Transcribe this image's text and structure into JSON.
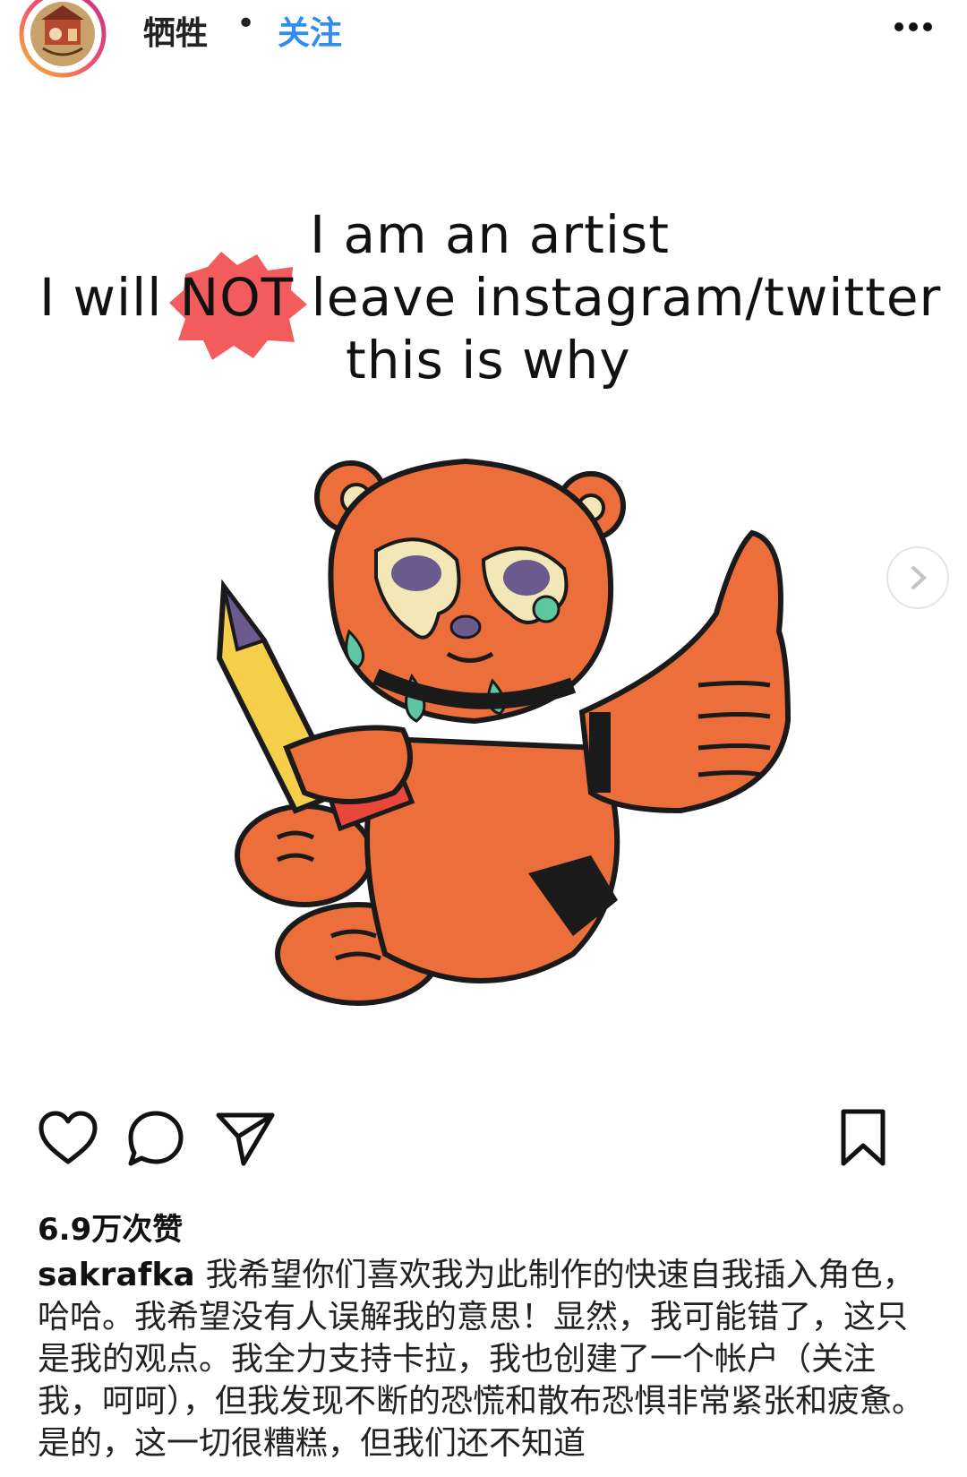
{
  "header": {
    "username": "牺牲",
    "separator": "•",
    "follow_label": "关注",
    "more_icon": "more-horizontal-icon"
  },
  "post": {
    "line1": "I am an artist",
    "line2_prefix": "I will ",
    "line2_highlight": "NOT",
    "line2_suffix": " leave instagram/twitter",
    "line3": "this is why",
    "highlight_color": "#f25c5c",
    "illustration": "crying-bear-thumbs-up-with-pencil"
  },
  "actions": {
    "like_icon": "heart-icon",
    "comment_icon": "comment-icon",
    "share_icon": "send-icon",
    "save_icon": "bookmark-icon"
  },
  "likes": "6.9万次赞",
  "caption": {
    "author": "sakrafka",
    "text": "我希望你们喜欢我为此制作的快速自我插入角色，哈哈。我希望没有人误解我的意思！显然，我可能错了，这只是我的观点。我全力支持卡拉，我也创建了一个帐户（关注我，呵呵），但我发现不断的恐慌和散布恐惧非常紧张和疲惫。是的，这一切很糟糕，但我们还不知道"
  },
  "colors": {
    "follow": "#2f8cf0",
    "bear": "#ec6e3a",
    "tears": "#5ec6a0"
  }
}
